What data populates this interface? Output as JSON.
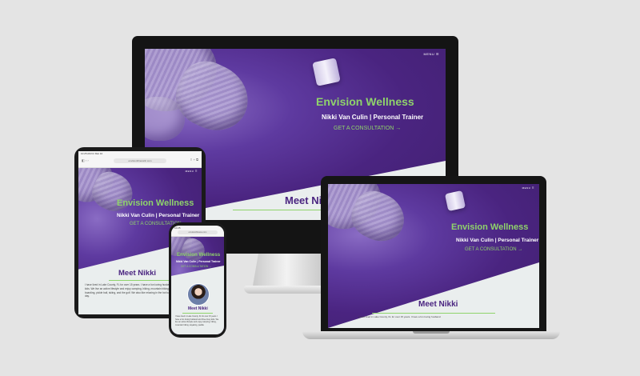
{
  "site": {
    "title": "Envision Wellness",
    "subtitle": "Nikki Van Culin | Personal Trainer",
    "cta": "GET A CONSULTATION →",
    "menu": "MENU ☰",
    "meet_heading": "Meet Nikki",
    "bio_tablet": "I have lived in Lake County, FL for over 15 years. I have a fun loving husband and three busy kids. We live an active lifestyle and enjoy camping, hiking, mountain biking, kayaking, paddle boarding, pickle ball, skiing, and the golf. We also like relaxing in the hot tub at the end of a long day.",
    "bio_laptop": "I have lived in Lake County, FL for over 15 years. I have a fun loving husband",
    "bio_phone": "I have lived in Lake County, FL for over 15 years. I have a fun loving husband and three busy kids. We live an active lifestyle and enjoy camping, hiking, mountain biking, kayaking, paddle"
  },
  "tablet_browser": {
    "status_left": "10:25 AM  Fri Mar 10",
    "url": "envisionfitnessllc.com"
  },
  "phone_browser": {
    "status_left": "10:25",
    "url": "envisionfitness.com"
  },
  "colors": {
    "brand_purple": "#4a2480",
    "accent_green": "#8fd36b",
    "light_section": "#eaeeee",
    "background": "#e4e4e4"
  }
}
